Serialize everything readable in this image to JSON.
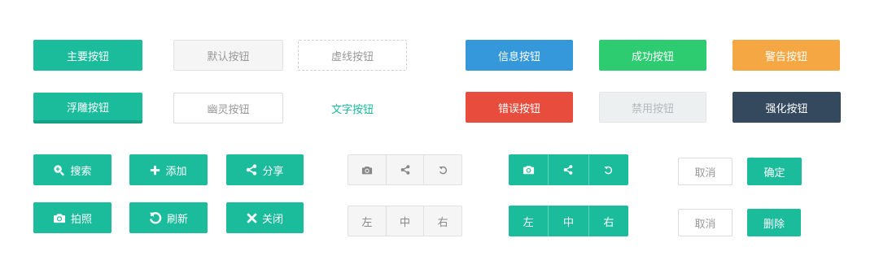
{
  "colors": {
    "primary": "#1ABC9C",
    "info": "#3498DB",
    "success": "#2ECC71",
    "warning": "#F4A742",
    "danger": "#E74C3C",
    "dark": "#34495E"
  },
  "row1": {
    "primary": "主要按钮",
    "default": "默认按钮",
    "dashed": "虚线按钮",
    "info": "信息按钮",
    "success": "成功按钮",
    "warning": "警告按钮"
  },
  "row2": {
    "raised": "浮雕按钮",
    "ghost": "幽灵按钮",
    "text": "文字按钮",
    "danger": "错误按钮",
    "disabled": "禁用按钮",
    "dark": "强化按钮"
  },
  "icon_buttons": {
    "search": {
      "label": "搜索",
      "icon": "search-plus-icon"
    },
    "add": {
      "label": "添加",
      "icon": "plus-icon"
    },
    "share": {
      "label": "分享",
      "icon": "share-icon"
    },
    "photo": {
      "label": "拍照",
      "icon": "camera-icon"
    },
    "refresh": {
      "label": "刷新",
      "icon": "refresh-icon"
    },
    "close": {
      "label": "关闭",
      "icon": "close-icon"
    }
  },
  "group_icons": [
    "camera-icon",
    "share-icon",
    "undo-icon"
  ],
  "group_text": {
    "left": "左",
    "center": "中",
    "right": "右"
  },
  "dialog1": {
    "cancel": "取消",
    "confirm": "确定"
  },
  "dialog2": {
    "cancel": "取消",
    "delete": "删除"
  }
}
